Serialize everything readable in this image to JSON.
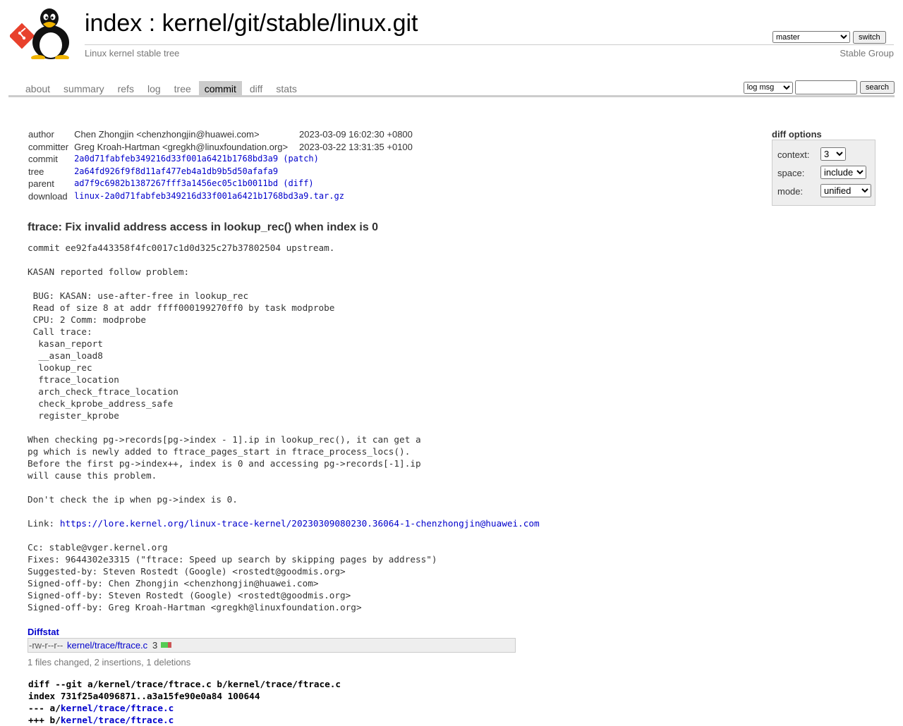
{
  "header": {
    "title_index": "index",
    "title_separator": " : ",
    "title_repo": "kernel/git/stable/linux.git",
    "subtitle": "Linux kernel stable tree",
    "owner": "Stable Group",
    "branch_selected": "master",
    "switch_label": "switch"
  },
  "tabs": [
    {
      "label": "about"
    },
    {
      "label": "summary"
    },
    {
      "label": "refs"
    },
    {
      "label": "log"
    },
    {
      "label": "tree"
    },
    {
      "label": "commit"
    },
    {
      "label": "diff"
    },
    {
      "label": "stats"
    }
  ],
  "search": {
    "type_selected": "log msg",
    "query": "",
    "button_label": "search"
  },
  "info": {
    "author_label": "author",
    "author_name": "Chen Zhongjin <chenzhongjin@huawei.com>",
    "author_date": "2023-03-09 16:02:30 +0800",
    "committer_label": "committer",
    "committer_name": "Greg Kroah-Hartman <gregkh@linuxfoundation.org>",
    "committer_date": "2023-03-22 13:31:35 +0100",
    "commit_label": "commit",
    "commit_hash": "2a0d71fabfeb349216d33f001a6421b1768bd3a9",
    "patch_link": "patch",
    "tree_label": "tree",
    "tree_hash": "2a64fd926f9f8d11af477eb4a1db9b5d50afafa9",
    "parent_label": "parent",
    "parent_hash": "ad7f9c6982b1387267fff3a1456ec05c1b0011bd",
    "diff_link": "diff",
    "download_label": "download",
    "download_file": "linux-2a0d71fabfeb349216d33f001a6421b1768bd3a9.tar.gz"
  },
  "diff_options": {
    "title": "diff options",
    "context_label": "context:",
    "context_value": "3",
    "space_label": "space:",
    "space_value": "include",
    "mode_label": "mode:",
    "mode_value": "unified"
  },
  "commit": {
    "subject": "ftrace: Fix invalid address access in lookup_rec() when index is 0",
    "body_before_link": "commit ee92fa443358f4fc0017c1d0d325c27b37802504 upstream.\n\nKASAN reported follow problem:\n\n BUG: KASAN: use-after-free in lookup_rec\n Read of size 8 at addr ffff000199270ff0 by task modprobe\n CPU: 2 Comm: modprobe\n Call trace:\n  kasan_report\n  __asan_load8\n  lookup_rec\n  ftrace_location\n  arch_check_ftrace_location\n  check_kprobe_address_safe\n  register_kprobe\n\nWhen checking pg->records[pg->index - 1].ip in lookup_rec(), it can get a\npg which is newly added to ftrace_pages_start in ftrace_process_locs().\nBefore the first pg->index++, index is 0 and accessing pg->records[-1].ip\nwill cause this problem.\n\nDon't check the ip when pg->index is 0.\n\n",
    "link_prefix": "Link: ",
    "link_url": "https://lore.kernel.org/linux-trace-kernel/20230309080230.36064-1-chenzhongjin@huawei.com",
    "body_after_link": "\n\nCc: stable@vger.kernel.org\nFixes: 9644302e3315 (\"ftrace: Speed up search by skipping pages by address\")\nSuggested-by: Steven Rostedt (Google) <rostedt@goodmis.org>\nSigned-off-by: Chen Zhongjin <chenzhongjin@huawei.com>\nSigned-off-by: Steven Rostedt (Google) <rostedt@goodmis.org>\nSigned-off-by: Greg Kroah-Hartman <gregkh@linuxfoundation.org>"
  },
  "diffstat": {
    "header": "Diffstat",
    "mode": "-rw-r--r--",
    "file": "kernel/trace/ftrace.c",
    "count": "3",
    "insertions": 2,
    "deletions": 1,
    "add_color": "#55cc55",
    "del_color": "#cc5555",
    "summary": "1 files changed, 2 insertions, 1 deletions"
  },
  "diff": {
    "git_line": "diff --git a/kernel/trace/ftrace.c b/kernel/trace/ftrace.c",
    "index_line": "index 731f25a4096871..a3a15fe90e0a84 100644",
    "minus_prefix": "--- a/",
    "plus_prefix": "+++ b/",
    "file": "kernel/trace/ftrace.c"
  }
}
